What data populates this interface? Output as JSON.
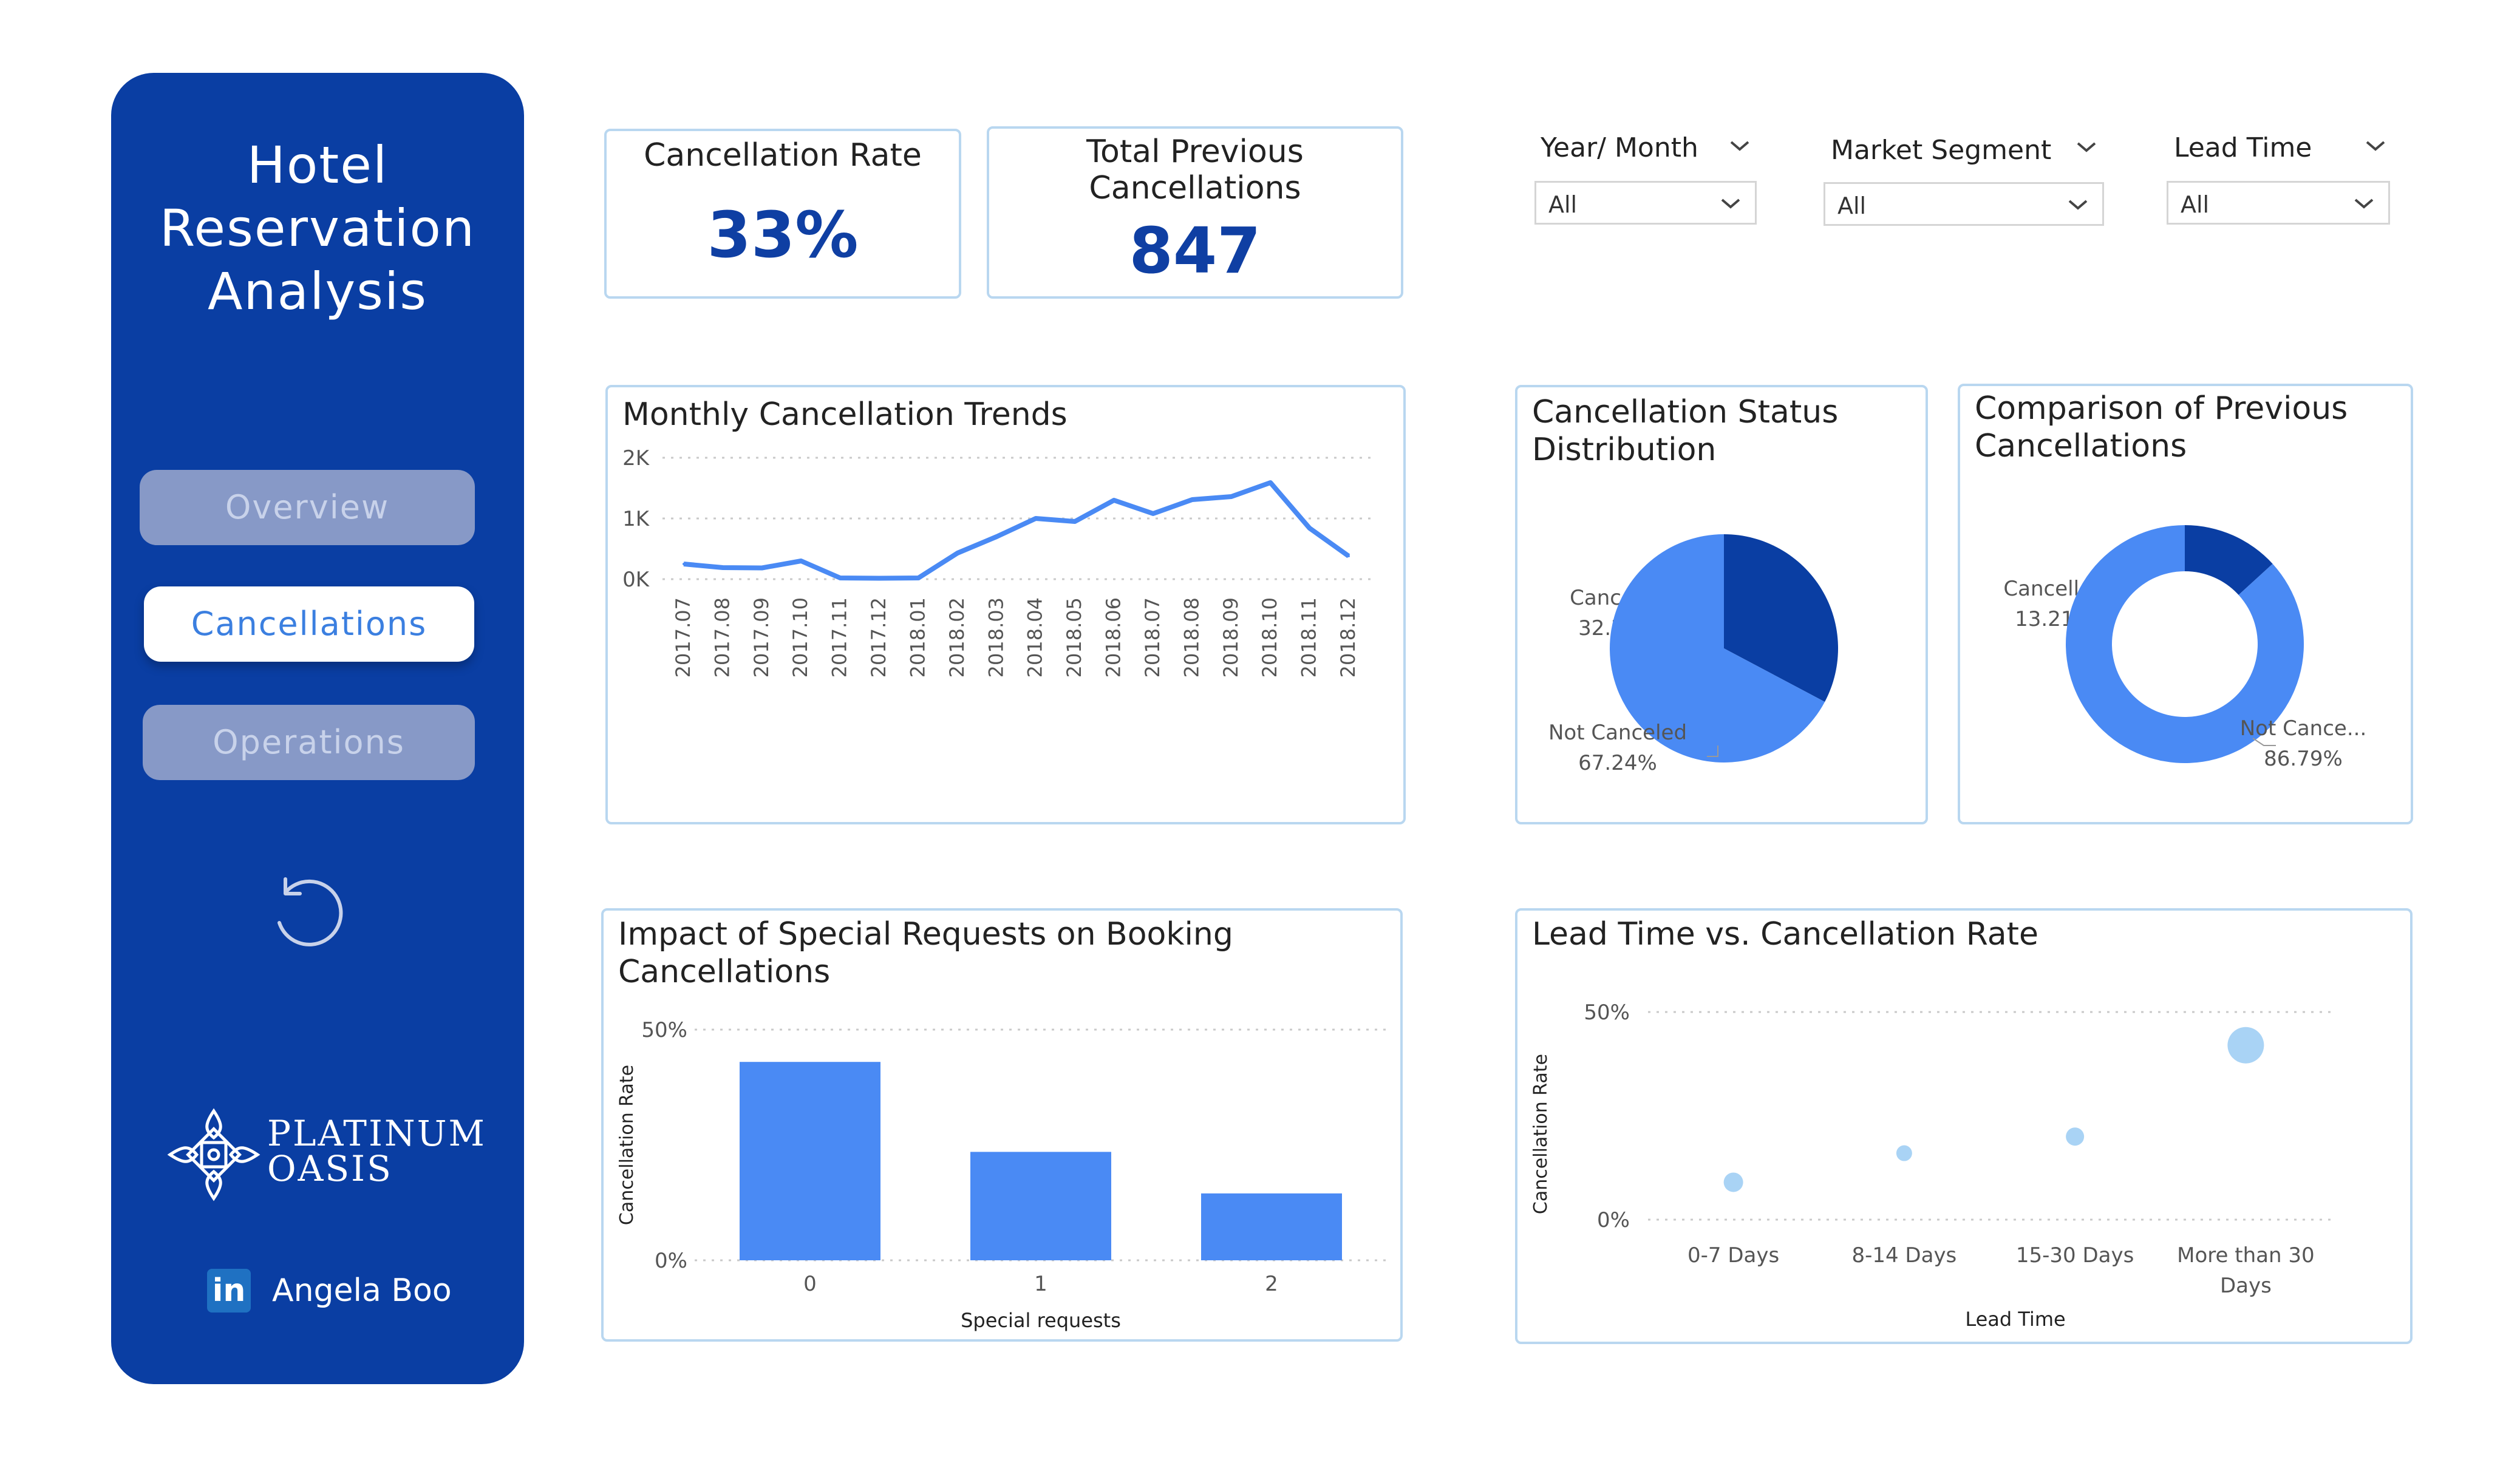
{
  "sidebar": {
    "title_lines": [
      "Hotel",
      "Reservation",
      "Analysis"
    ],
    "nav": {
      "overview": "Overview",
      "cancellations": "Cancellations",
      "operations": "Operations"
    },
    "logo": {
      "line1": "PLATINUM",
      "line2": "OASIS"
    },
    "author": "Angela Boo",
    "linkedin_glyph": "in"
  },
  "kpis": {
    "cancellation_rate": {
      "label": "Cancellation Rate",
      "value": "33%"
    },
    "previous_cancellations": {
      "label_line1": "Total Previous",
      "label_line2": "Cancellations",
      "value": "847"
    }
  },
  "filters": {
    "year_month": {
      "title": "Year/ Month",
      "value": "All"
    },
    "market_segment": {
      "title": "Market Segment",
      "value": "All"
    },
    "lead_time": {
      "title": "Lead Time",
      "value": "All"
    }
  },
  "colors": {
    "accent": "#4a8af4",
    "dark": "#0a3ea3",
    "light": "#a9d3f5"
  },
  "chart_data": [
    {
      "id": "monthly",
      "type": "line",
      "title": "Monthly Cancellation Trends",
      "x": [
        "2017.07",
        "2017.08",
        "2017.09",
        "2017.10",
        "2017.11",
        "2017.12",
        "2018.01",
        "2018.02",
        "2018.03",
        "2018.04",
        "2018.05",
        "2018.06",
        "2018.07",
        "2018.08",
        "2018.09",
        "2018.10",
        "2018.11",
        "2018.12"
      ],
      "values": [
        250,
        190,
        185,
        300,
        20,
        15,
        20,
        430,
        700,
        1000,
        950,
        1300,
        1080,
        1310,
        1360,
        1590,
        840,
        380
      ],
      "ylim": [
        0,
        2000
      ],
      "yticks": [
        {
          "v": 2000,
          "label": "2K"
        },
        {
          "v": 1000,
          "label": "1K"
        },
        {
          "v": 0,
          "label": "0K"
        }
      ],
      "grid": true
    },
    {
      "id": "status",
      "type": "pie",
      "title_lines": [
        "Cancellation Status",
        "Distribution"
      ],
      "slices": [
        {
          "label": "Canceled",
          "value": 32.76,
          "display": "32.76%"
        },
        {
          "label": "Not Canceled",
          "value": 67.24,
          "display": "67.24%"
        }
      ]
    },
    {
      "id": "previous",
      "type": "pie",
      "title_lines": [
        "Comparison of Previous",
        "Cancellations"
      ],
      "slices": [
        {
          "label": "Cancelled",
          "value": 13.21,
          "display": "13.21%"
        },
        {
          "label": "Not Cance...",
          "value": 86.79,
          "display": "86.79%"
        }
      ]
    },
    {
      "id": "special",
      "type": "bar",
      "title": "Impact of Special Requests on Booking Cancellations",
      "categories": [
        "0",
        "1",
        "2"
      ],
      "values": [
        43,
        23.5,
        14.5
      ],
      "xlabel": "Special requests",
      "ylabel": "Cancellation Rate",
      "ylim": [
        0,
        50
      ],
      "yticks": [
        {
          "v": 50,
          "label": "50%"
        },
        {
          "v": 0,
          "label": "0%"
        }
      ],
      "grid": true
    },
    {
      "id": "leadtime",
      "type": "scatter",
      "title": "Lead Time vs. Cancellation Rate",
      "categories": [
        "0-7 Days",
        "8-14 Days",
        "15-30 Days",
        "More than 30 Days"
      ],
      "values": [
        9,
        16,
        20,
        42
      ],
      "xlabel": "Lead Time",
      "ylabel": "Cancellation Rate",
      "ylim": [
        0,
        50
      ],
      "yticks": [
        {
          "v": 50,
          "label": "50%"
        },
        {
          "v": 0,
          "label": "0%"
        }
      ],
      "grid": true
    }
  ]
}
